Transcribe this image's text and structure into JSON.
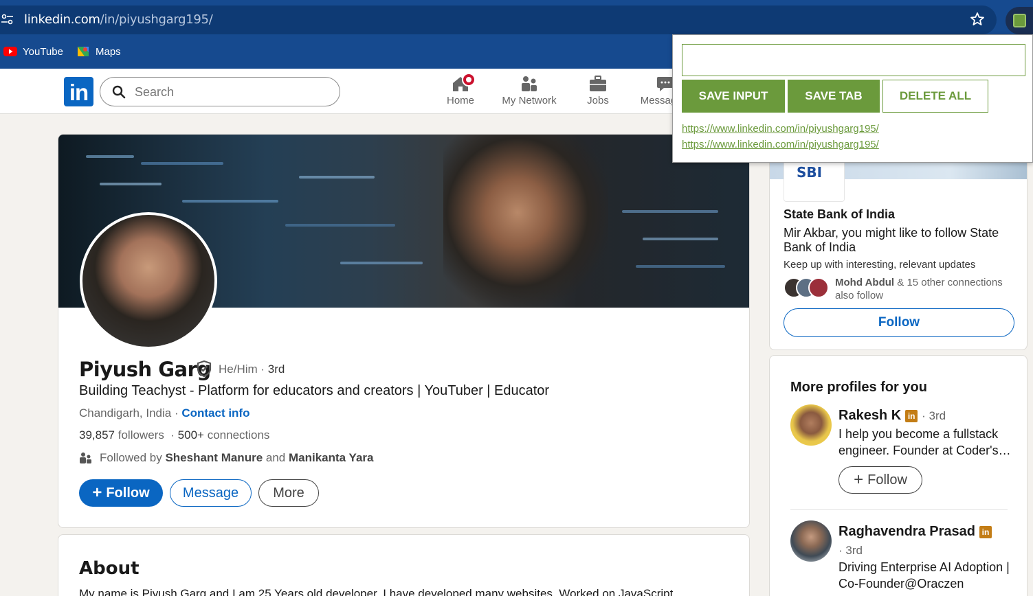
{
  "browser": {
    "url_domain": "linkedin.com",
    "url_path": "/in/piyushgarg195/",
    "bookmarks": [
      {
        "label": "YouTube",
        "icon": "youtube-icon"
      },
      {
        "label": "Maps",
        "icon": "maps-icon"
      }
    ]
  },
  "nav": {
    "logo": "in",
    "search_placeholder": "Search",
    "items": [
      {
        "label": "Home",
        "icon": "home-icon"
      },
      {
        "label": "My Network",
        "icon": "network-icon"
      },
      {
        "label": "Jobs",
        "icon": "jobs-icon"
      },
      {
        "label": "Messaging",
        "icon": "messaging-icon"
      }
    ]
  },
  "profile": {
    "name": "Piyush Garg",
    "pronouns": "He/Him",
    "degree": "3rd",
    "headline": "Building Teachyst - Platform for educators and creators | YouTuber | Educator",
    "location": "Chandigarh, India",
    "contact_label": "Contact info",
    "followers_count": "39,857",
    "followers_label": "followers",
    "connections_count": "500+",
    "connections_label": "connections",
    "followed_by_prefix": "Followed by",
    "followed_by_1": "Sheshant Manure",
    "followed_by_and": "and",
    "followed_by_2": "Manikanta Yara",
    "follow_label": "Follow",
    "message_label": "Message",
    "more_label": "More"
  },
  "about": {
    "title": "About",
    "text": "My name is Piyush Garg and I am 25 Years old developer. I have developed many websites. Worked on JavaScript"
  },
  "sidebar": {
    "company": {
      "logo_text": "SBI",
      "name": "State Bank of India",
      "message": "Mir Akbar, you might like to follow State Bank of India",
      "subtext": "Keep up with interesting, relevant updates",
      "connection_name": "Mohd Abdul",
      "connection_rest": "& 15 other connections also follow",
      "follow_label": "Follow"
    },
    "more_profiles": {
      "title": "More profiles for you",
      "items": [
        {
          "name": "Rakesh K",
          "degree": "· 3rd",
          "description": "I help you become a fullstack engineer. Founder at Coder's…",
          "follow_label": "Follow"
        },
        {
          "name": "Raghavendra Prasad",
          "degree": "· 3rd",
          "description": "Driving Enterprise AI Adoption | Co-Founder@Oraczen"
        }
      ]
    }
  },
  "extension": {
    "input_value": "",
    "save_input_label": "SAVE INPUT",
    "save_tab_label": "SAVE TAB",
    "delete_all_label": "DELETE ALL",
    "saved_links": [
      "https://www.linkedin.com/in/piyushgarg195/",
      "https://www.linkedin.com/in/piyushgarg195/"
    ],
    "accent_color": "#6b9a3c"
  },
  "colors": {
    "linkedin_blue": "#0a66c2",
    "browser_bar": "#164a8f",
    "notification_red": "#cb112d"
  }
}
